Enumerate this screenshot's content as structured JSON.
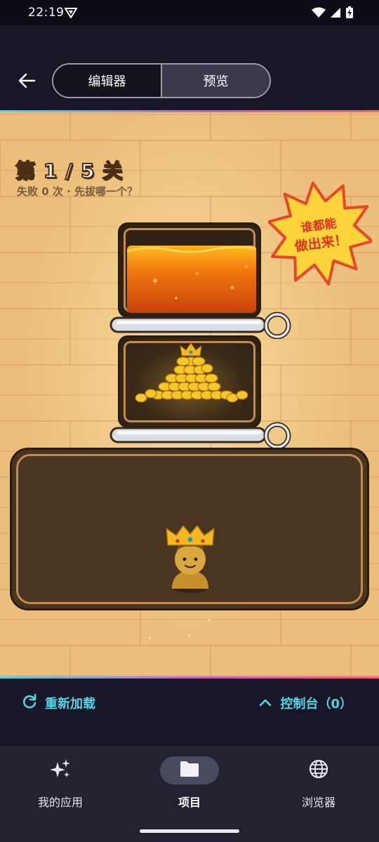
{
  "status_bar": {
    "time": "22:19",
    "icons": [
      "vpn-shield-icon",
      "wifi-icon",
      "cell-signal-icon",
      "battery-charging-icon"
    ]
  },
  "header": {
    "back_icon": "arrow-left-icon",
    "tabs": [
      {
        "label": "编辑器",
        "selected": false
      },
      {
        "label": "预览",
        "selected": true
      }
    ]
  },
  "game": {
    "level_title": "第 1 / 5 关",
    "subtitle": "失败 0 次 · 先拔哪一个？",
    "burst_text": [
      "谁都能",
      "做出来！"
    ],
    "tanks": [
      "lava",
      "gold-and-crown",
      "king"
    ],
    "pins": [
      "top-pin",
      "bottom-pin"
    ]
  },
  "console_bar": {
    "reload_label": "重新加载",
    "console_label": "控制台（0）",
    "accent_color": "#53d6e6"
  },
  "bottom_nav": {
    "items": [
      {
        "label": "我的应用",
        "icon": "sparkles-icon",
        "selected": false
      },
      {
        "label": "项目",
        "icon": "folder-icon",
        "selected": true
      },
      {
        "label": "浏览器",
        "icon": "globe-icon",
        "selected": false
      }
    ]
  },
  "colors": {
    "background": "#171727",
    "gradient_start": "#4fd6e4",
    "gradient_end": "#ff5d75",
    "wall": "#ecc07c",
    "lava": "#f27a10",
    "burst_fill": "#ffd43a",
    "burst_text": "#e0301e"
  }
}
